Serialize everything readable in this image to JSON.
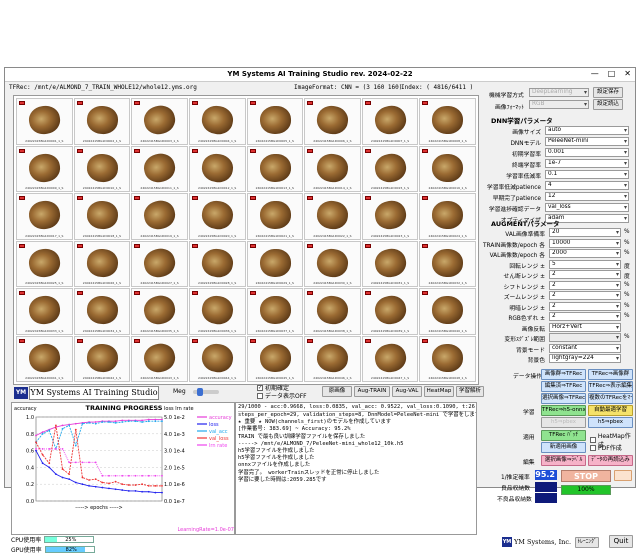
{
  "window": {
    "title": "YM Systems AI Training Studio  rev. 2024-02-22",
    "minimize": "—",
    "maximize": "□",
    "close": "✕"
  },
  "pathbar": {
    "trec": "TFRec: /mnt/e/ALMOND_7_TRAIN_WHOLE12/whole12.yms.org",
    "format": "ImageFormat: CNN = (3 160 160)",
    "index": "Index: ( 4816/6411 )"
  },
  "thumbnails": [
    "24022415BG1D0001_1_S",
    "24022415BG1D0002_1_S",
    "24022415BG1D0003_1_S",
    "24022415BG1D0004_1_S",
    "24022415BG1D0005_1_S",
    "24022415BG1D0006_1_S",
    "24022415BG1D0007_1_S",
    "24022415BG1D0008_1_S",
    "24022415BG1D0009_1_S",
    "24022415BG1D0010_1_S",
    "24022415BG1D0011_1_S",
    "24022415BG1D0012_1_S",
    "24022415BG1D0013_1_S",
    "24022415BG1D0014_1_S",
    "24022415BG1D0015_1_S",
    "24022415BG1D0016_1_S",
    "24022415BG1D0017_1_S",
    "24022415BG1D0018_1_S",
    "24022415BG1D0019_1_S",
    "24022415BG1D0020_1_S",
    "24022415BG1D0021_1_S",
    "24022415BG1D0022_1_S",
    "24022415BG1D0023_1_S",
    "24022415BG1D0024_1_S",
    "24022415BG1D0025_1_S",
    "24022415BG1D0026_1_S",
    "24022415BG1D0027_1_S",
    "24022415BG1D0028_1_S",
    "24022415BG1D0029_1_S",
    "24022415BG1D0030_1_S",
    "24022415BG1D0031_1_S",
    "24022415BG1D0032_1_S",
    "24022415BG1D0033_1_S",
    "24022415BG1D0034_1_S",
    "24022415BG1D0035_1_S",
    "24022415BG1D0036_1_S",
    "24022415BG1D0037_1_S",
    "24022415BG1D0038_1_S",
    "24022415BG1D0039_1_S",
    "24022415BG1D0040_1_S",
    "24022415BG1D0041_1_S",
    "24022415BG1D0042_1_S",
    "24022415BG1D0043_1_S",
    "24022415BG1D0044_1_S",
    "24022415BG1D0045_1_S",
    "24022415BG1D0046_1_S",
    "24022415BG1D0047_1_S",
    "24022415BG1D0048_1_S"
  ],
  "bottom": {
    "logo": "YM",
    "app_name": "YM Systems AI Training Studio",
    "meg_label": "Meg",
    "chk_accurate": "初期確定",
    "chk_data": "データ表示OFF",
    "tabs": [
      "原画像",
      "Aug-TRAIN",
      "Aug-VAL",
      "HeatMap",
      "学習解析"
    ]
  },
  "progress": {
    "title": "TRAINING PROGRESS",
    "left_label": "accuracy",
    "right_label": "loss  lrn rate",
    "y_left": [
      "1.0",
      "0.8",
      "0.6",
      "0.4",
      "0.2",
      "0.0"
    ],
    "y_right": [
      "5.0 1e-2",
      "4.0 1e-3",
      "3.0 1e-4",
      "2.0 1e-5",
      "1.0 1e-6",
      "0.0 1e-7"
    ],
    "x_label": "epochs",
    "legend": [
      "accuracy",
      "loss",
      "val_acc",
      "val_loss",
      "lrn rate"
    ],
    "legend_colors": [
      "#e63ad8",
      "#2222ee",
      "#22aaee",
      "#ee3333",
      "#ee44ee"
    ],
    "lr_note": "LearningRate=1.0e-07",
    "cpu_label": "CPU使用率",
    "cpu_value": "25%",
    "gpu_label": "GPU使用率",
    "gpu_value": "82%"
  },
  "chart_data": {
    "type": "line",
    "title": "TRAINING PROGRESS",
    "xlabel": "epochs",
    "ylabel": "accuracy",
    "ylim": [
      0,
      1.0
    ],
    "x": [
      1,
      2,
      3,
      4,
      5,
      6,
      7,
      8,
      9,
      10,
      11,
      12,
      13,
      14,
      15,
      16,
      17,
      18,
      19,
      20
    ],
    "series": [
      {
        "name": "accuracy",
        "color": "#e63ad8",
        "values": [
          0.78,
          0.82,
          0.85,
          0.88,
          0.9,
          0.91,
          0.92,
          0.93,
          0.94,
          0.94,
          0.95,
          0.95,
          0.95,
          0.96,
          0.96,
          0.96,
          0.96,
          0.97,
          0.97,
          0.97
        ]
      },
      {
        "name": "val_acc",
        "color": "#22aaee",
        "values": [
          0.7,
          0.8,
          0.84,
          0.62,
          0.86,
          0.9,
          0.66,
          0.92,
          0.93,
          0.92,
          0.94,
          0.94,
          0.93,
          0.94,
          0.95,
          0.95,
          0.94,
          0.95,
          0.95,
          0.95
        ]
      },
      {
        "name": "loss",
        "color": "#2222ee",
        "values": [
          0.6,
          0.45,
          0.4,
          0.32,
          0.28,
          0.26,
          0.22,
          0.2,
          0.18,
          0.17,
          0.16,
          0.15,
          0.14,
          0.13,
          0.12,
          0.12,
          0.11,
          0.11,
          0.1,
          0.1
        ]
      },
      {
        "name": "val_loss",
        "color": "#ee3333",
        "values": [
          0.7,
          0.55,
          0.45,
          0.9,
          0.38,
          0.32,
          0.85,
          0.28,
          0.25,
          0.26,
          0.22,
          0.21,
          0.23,
          0.2,
          0.19,
          0.19,
          0.2,
          0.18,
          0.18,
          0.18
        ]
      },
      {
        "name": "lrn rate",
        "color": "#ee44ee",
        "values": [
          0.62,
          0.62,
          0.62,
          0.62,
          0.62,
          0.46,
          0.46,
          0.46,
          0.46,
          0.46,
          0.3,
          0.3,
          0.3,
          0.3,
          0.3,
          0.3,
          0.3,
          0.3,
          0.3,
          0.3
        ]
      }
    ]
  },
  "log": {
    "status": "29/1000 - acc:0.9668, loss:0.0835, val_acc: 0.9522, val_loss:0.1090, t:26.1s, lr:1.0e-07",
    "lines": [
      "steps_per_epoch=29, validation_steps=8, DnnModel=PeleeNet-mini で学習をします",
      "★ 重要 ★ NOW(channels_first)のモデルを作成しています",
      "[作業番号: 383.69] ~ Accuracy: 95.2%",
      "TRAIN で最も良い訓練学習ファイルを保存しました",
      "   -----> /mnt/e/ALMOND_7/PeleeNet-mini_whole12_10k.h5",
      "h5学習ファイルを作成しました",
      "h5学習ファイルを作成しました",
      "onnxファイルを作成しました",
      "学習完了。 workerTrainスレッドを正常に停止しました",
      "学習に要した時間は:2059.285です"
    ]
  },
  "right": {
    "learn_method_label": "機械学習方式",
    "learn_method": "DeepLearning",
    "image_format_label": "画像ﾌｫｰﾏｯﾄ",
    "image_format": "RGB",
    "save_settings": "設定保存",
    "load_settings": "設定読込",
    "dnn_section": "DNN学習パラメータ",
    "dnn_params": [
      {
        "label": "画像サイズ",
        "value": "auto"
      },
      {
        "label": "DNNモデル",
        "value": "PeleeNet-mini"
      },
      {
        "label": "初期学習率",
        "value": "0.001"
      },
      {
        "label": "終端学習率",
        "value": "1e-7"
      },
      {
        "label": "学習率低減率",
        "value": "0.1"
      },
      {
        "label": "学習率低減patience",
        "value": "4"
      },
      {
        "label": "早期完了patience",
        "value": "12"
      },
      {
        "label": "学習進捗確認データ",
        "value": "val_loss"
      },
      {
        "label": "オプティマイザ",
        "value": "adam"
      }
    ],
    "aug_section": "AUGMENTパラメータ",
    "aug_params": [
      {
        "label": "VAL画像準備率",
        "value": "20",
        "unit": "%"
      },
      {
        "label": "TRAIN画像数/epoch 各",
        "value": "10000",
        "unit": "%"
      },
      {
        "label": "VAL画像数/epoch 各",
        "value": "2000",
        "unit": "%"
      },
      {
        "label": "回転レンジ ±",
        "value": "5",
        "unit": "度"
      },
      {
        "label": "せん断レンジ ±",
        "value": "2",
        "unit": "度"
      },
      {
        "label": "シフトレンジ ±",
        "value": "2",
        "unit": "%"
      },
      {
        "label": "ズームレンジ ±",
        "value": "2",
        "unit": "%"
      },
      {
        "label": "明暗レンジ ±",
        "value": "2",
        "unit": "%"
      },
      {
        "label": "RGB色ずれ ±",
        "value": "2",
        "unit": "%"
      },
      {
        "label": "画像反転",
        "value": "Horz+Vert",
        "unit": ""
      },
      {
        "label": "変形ｽｸﾞｽﾞﾚ範囲",
        "value": "",
        "unit": "%"
      },
      {
        "label": "背景モード",
        "value": "constant",
        "unit": ""
      },
      {
        "label": "背景色",
        "value": "lightgray=224",
        "unit": ""
      }
    ],
    "data_ops_label": "データ操作",
    "data_ops": [
      "画像群⇒TFRec",
      "TFRec⇒画像群",
      "編集済⇒TFRec",
      "TFRec⇒表示編集",
      "選択画像⇒TFRec",
      "複数のTFRecをﾏｰｼﾞ"
    ],
    "learn_label": "学習",
    "learn_ops": [
      "TFRec⇒h5-onnx",
      "自動最適学習",
      "h5⇒pbex",
      "h5⇒pbex"
    ],
    "apply_label": "適用",
    "apply_btn": "TFRec ﾊﾞｯﾁ",
    "heatmap_chk": "HeatMap作成",
    "new_apply": "新適用画像",
    "pdf_chk": "PDF作成",
    "edit_label": "編集",
    "edit_btn1": "選択画像⇒ﾗﾍﾞﾙ",
    "edit_btn2": "ﾃﾞｰﾀの再読込み",
    "count_label1": "1/推定確率",
    "count_val1": "95.2",
    "count_label2": "良品収納数",
    "count_label3": "不良品収納数",
    "stop_btn": "STOP",
    "progress_pct": "100%",
    "progress_value": 1.0,
    "company": "YM Systems, Inc.",
    "small_btn": "ﾄﾚｰﾆﾝｸﾞ",
    "quit": "Quit"
  }
}
